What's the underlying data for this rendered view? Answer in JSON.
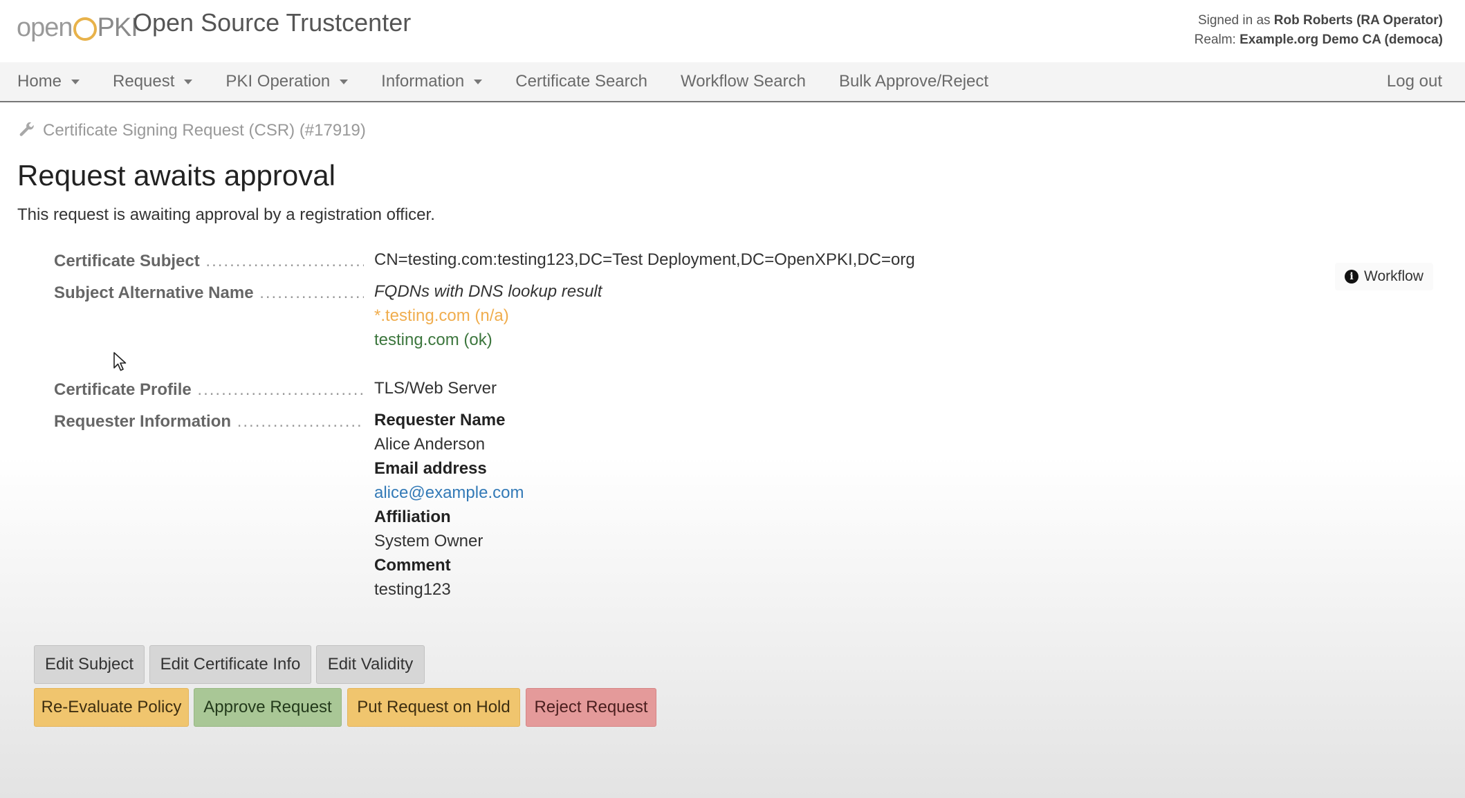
{
  "header": {
    "logo_text_pre": "open",
    "logo_text_post": "PKI",
    "title": "Open Source Trustcenter",
    "signed_in_prefix": "Signed in as",
    "signed_in_user": "Rob Roberts (RA Operator)",
    "realm_prefix": "Realm:",
    "realm_value": "Example.org Demo CA (democa)"
  },
  "nav": {
    "items": [
      {
        "label": "Home",
        "dropdown": true
      },
      {
        "label": "Request",
        "dropdown": true
      },
      {
        "label": "PKI Operation",
        "dropdown": true
      },
      {
        "label": "Information",
        "dropdown": true
      },
      {
        "label": "Certificate Search",
        "dropdown": false
      },
      {
        "label": "Workflow Search",
        "dropdown": false
      },
      {
        "label": "Bulk Approve/Reject",
        "dropdown": false
      }
    ],
    "logout": "Log out"
  },
  "breadcrumb": "Certificate Signing Request (CSR) (#17919)",
  "page": {
    "title": "Request awaits approval",
    "description": "This request is awaiting approval by a registration officer."
  },
  "workflow_button": "Workflow",
  "details": {
    "subject_label": "Certificate Subject",
    "subject_value": "CN=testing.com:testing123,DC=Test Deployment,DC=OpenXPKI,DC=org",
    "san_label": "Subject Alternative Name",
    "san_heading": "FQDNs with DNS lookup result",
    "san_entries": [
      {
        "text": "*.testing.com (n/a)",
        "status": "warning"
      },
      {
        "text": "testing.com (ok)",
        "status": "ok"
      }
    ],
    "profile_label": "Certificate Profile",
    "profile_value": "TLS/Web Server",
    "requester_label": "Requester Information",
    "requester": {
      "name_label": "Requester Name",
      "name": "Alice Anderson",
      "email_label": "Email address",
      "email": "alice@example.com",
      "affiliation_label": "Affiliation",
      "affiliation": "System Owner",
      "comment_label": "Comment",
      "comment": "testing123"
    }
  },
  "buttons": {
    "edit_subject": "Edit Subject",
    "edit_cert_info": "Edit Certificate Info",
    "edit_validity": "Edit Validity",
    "re_evaluate": "Re-Evaluate Policy",
    "approve": "Approve Request",
    "hold": "Put Request on Hold",
    "reject": "Reject Request"
  },
  "colors": {
    "warning": "#f0ad4e",
    "ok": "#3c763d",
    "link": "#337ab7",
    "btn_default": "#d6d6d6",
    "btn_warning": "#f0c56e",
    "btn_success": "#a9c796",
    "btn_danger": "#e49a9a"
  }
}
